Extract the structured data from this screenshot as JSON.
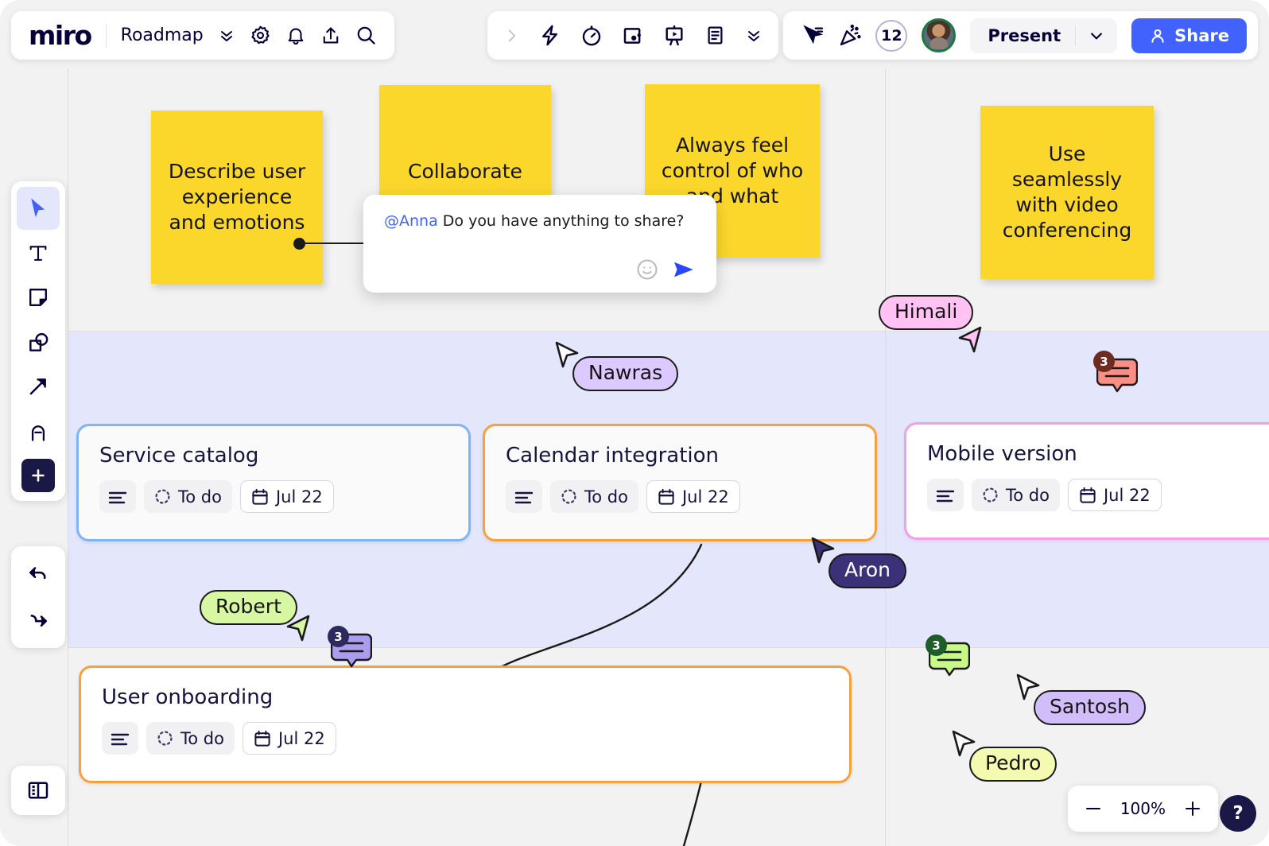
{
  "header": {
    "logo": "miro",
    "board_name": "Roadmap",
    "left_icons": [
      "chevron-down-double-icon",
      "gear-icon",
      "bell-icon",
      "upload-icon",
      "search-icon"
    ],
    "center_icons": [
      "chevron-right-icon",
      "lightning-icon",
      "timer-icon",
      "frame-icon",
      "presentation-icon",
      "document-icon",
      "chevron-down-double-icon"
    ],
    "right_icons": [
      "cursor-share-icon",
      "celebrate-icon"
    ],
    "participant_count": "12",
    "present_label": "Present",
    "share_label": "Share",
    "accent_color": "#4262ff"
  },
  "toolbar": {
    "tools": [
      {
        "name": "select-tool",
        "icon": "cursor-icon",
        "active": true
      },
      {
        "name": "text-tool",
        "icon": "text-icon",
        "active": false
      },
      {
        "name": "sticky-note-tool",
        "icon": "sticky-note-icon",
        "active": false
      },
      {
        "name": "shapes-tool",
        "icon": "shapes-icon",
        "active": false
      },
      {
        "name": "arrow-tool",
        "icon": "arrow-icon",
        "active": false
      },
      {
        "name": "pen-tool",
        "icon": "pen-icon",
        "active": false
      },
      {
        "name": "more-apps-tool",
        "icon": "plus-icon",
        "active": false
      }
    ],
    "undo": "undo-icon",
    "redo": "redo-icon",
    "panel": "panel-toggle-icon"
  },
  "stickies": [
    {
      "text": "Describe user experience and emotions",
      "color": "#fcd72b"
    },
    {
      "text": "Collaborate",
      "color": "#fcd72b"
    },
    {
      "text": "Always feel control of who and what",
      "color": "#fcd72b"
    },
    {
      "text": "Use seamlessly with video conferencing",
      "color": "#fcd72b"
    }
  ],
  "comment_popup": {
    "mention": "@Anna",
    "message": " Do you have anything to share?",
    "emoji_icon": "emoji-icon",
    "send_icon": "send-icon"
  },
  "cards": [
    {
      "title": "Service catalog",
      "status": "To do",
      "date": "Jul 22",
      "border_color": "#7fb4f5"
    },
    {
      "title": "Calendar integration",
      "status": "To do",
      "date": "Jul 22",
      "border_color": "#f9a03c"
    },
    {
      "title": "Mobile version",
      "status": "To do",
      "date": "Jul 22",
      "border_color": "#f99ce6"
    },
    {
      "title": "User onboarding",
      "status": "To do",
      "date": "Jul 22",
      "border_color": "#f9a03c"
    }
  ],
  "collaborators": [
    {
      "name": "Nawras",
      "pill_bg": "#dcc9ff",
      "text_color": "#141414",
      "cursor_fill": "#ffffff"
    },
    {
      "name": "Himali",
      "pill_bg": "#ffc2f2",
      "text_color": "#141414",
      "cursor_fill": "#ffc2f2"
    },
    {
      "name": "Aron",
      "pill_bg": "#3b3178",
      "text_color": "#ffffff",
      "cursor_fill": "#3b3178"
    },
    {
      "name": "Robert",
      "pill_bg": "#d7f7a3",
      "text_color": "#141414",
      "cursor_fill": "#d7f7a3"
    },
    {
      "name": "Santosh",
      "pill_bg": "#d2bdfb",
      "text_color": "#141414",
      "cursor_fill": "#ffffff"
    },
    {
      "name": "Pedro",
      "pill_bg": "#f4fbb0",
      "text_color": "#141414",
      "cursor_fill": "#ffffff"
    }
  ],
  "comment_bubbles": [
    {
      "count": "3",
      "bubble_color": "#f98e84",
      "badge_color": "#6e2b22"
    },
    {
      "count": "3",
      "bubble_color": "#ab9cf0",
      "badge_color": "#2e2a5e"
    },
    {
      "count": "3",
      "bubble_color": "#c6f985",
      "badge_color": "#1e5c29"
    }
  ],
  "zoom": {
    "level": "100%",
    "minus_icon": "minus-icon",
    "plus_icon": "plus-icon",
    "help_label": "?"
  }
}
